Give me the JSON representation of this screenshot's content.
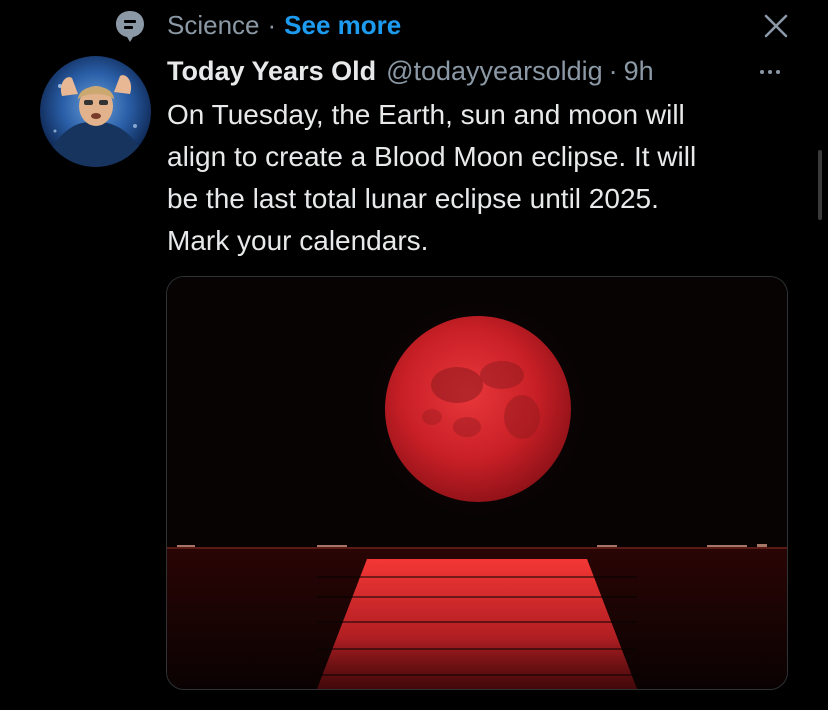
{
  "topic": {
    "icon": "topic-icon",
    "name": "Science",
    "separator": "·",
    "see_more": "See more",
    "close_icon": "close-icon"
  },
  "tweet": {
    "display_name": "Today Years Old",
    "handle": "@todayyearsoldig",
    "separator": "·",
    "time": "9h",
    "more_icon": "more-icon",
    "text": "On Tuesday, the Earth, sun and moon will\nalign to create a Blood Moon eclipse. It will\nbe the last total lunar eclipse until 2025.\nMark your calendars."
  },
  "colors": {
    "background": "#000000",
    "text": "#e7e9ea",
    "muted": "#8b98a5",
    "link": "#1d9bf0",
    "moon": "#d7262d"
  }
}
